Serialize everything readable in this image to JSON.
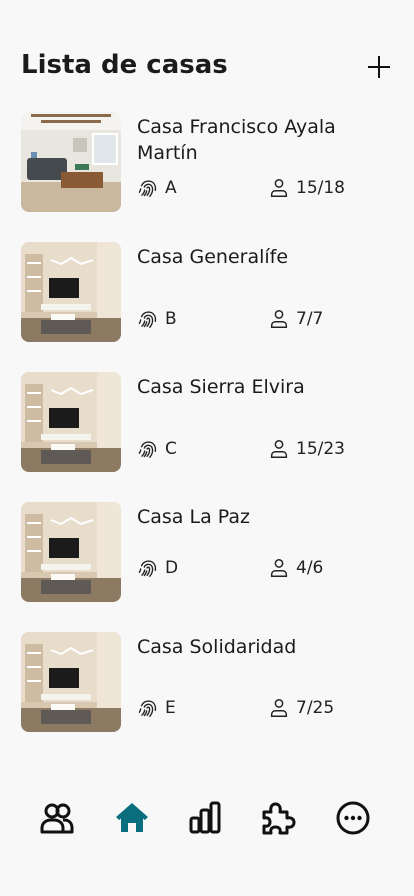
{
  "header": {
    "title": "Lista de casas",
    "add_icon": "plus-icon"
  },
  "houses": [
    {
      "name": "Casa Francisco Ayala Martín",
      "code": "A",
      "occupancy": "15/18",
      "image": "living-room-photo"
    },
    {
      "name": "Casa Generalífe",
      "code": "B",
      "occupancy": "7/7",
      "image": "tv-room-photo"
    },
    {
      "name": "Casa Sierra Elvira",
      "code": "C",
      "occupancy": "15/23",
      "image": "tv-room-photo"
    },
    {
      "name": "Casa La Paz",
      "code": "D",
      "occupancy": "4/6",
      "image": "tv-room-photo"
    },
    {
      "name": "Casa Solidaridad",
      "code": "E",
      "occupancy": "7/25",
      "image": "tv-room-photo"
    }
  ],
  "nav": {
    "items": [
      {
        "icon": "users-icon",
        "active": false
      },
      {
        "icon": "home-icon",
        "active": true
      },
      {
        "icon": "bar-chart-icon",
        "active": false
      },
      {
        "icon": "puzzle-icon",
        "active": false
      },
      {
        "icon": "more-icon",
        "active": false
      }
    ],
    "active_color": "#0b6e7f",
    "inactive_color": "#111111"
  }
}
